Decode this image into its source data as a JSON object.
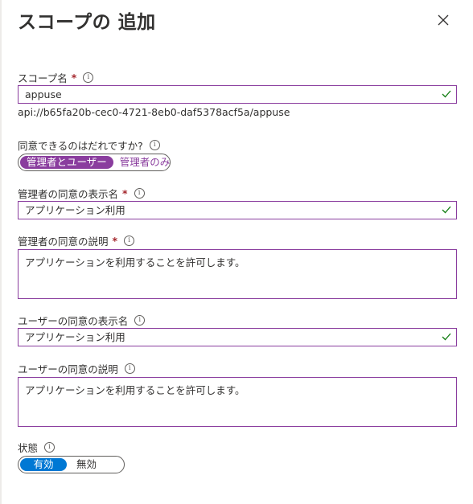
{
  "header": {
    "title": "スコープの 追加"
  },
  "fields": {
    "scope_name": {
      "label": "スコープ名",
      "value": "appuse",
      "helper": "api://b65fa20b-cec0-4721-8eb0-daf5378acf5a/appuse"
    },
    "who_can_consent": {
      "label": "同意できるのはだれですか?",
      "options": [
        "管理者とユーザー",
        "管理者のみ"
      ],
      "selected": "管理者とユーザー"
    },
    "admin_display_name": {
      "label": "管理者の同意の表示名",
      "value": "アプリケーション利用"
    },
    "admin_description": {
      "label": "管理者の同意の説明",
      "value": "アプリケーションを利用することを許可します。"
    },
    "user_display_name": {
      "label": "ユーザーの同意の表示名",
      "value": "アプリケーション利用"
    },
    "user_description": {
      "label": "ユーザーの同意の説明",
      "value": "アプリケーションを利用することを許可します。"
    },
    "state": {
      "label": "状態",
      "options": [
        "有効",
        "無効"
      ],
      "selected": "有効"
    }
  },
  "colors": {
    "accent_purple": "#8a3d9e",
    "accent_blue": "#0078d4",
    "required_red": "#a4262c",
    "valid_green": "#107c10"
  },
  "icons": {
    "close": "close-icon",
    "info": "info-icon",
    "check": "checkmark-icon"
  }
}
